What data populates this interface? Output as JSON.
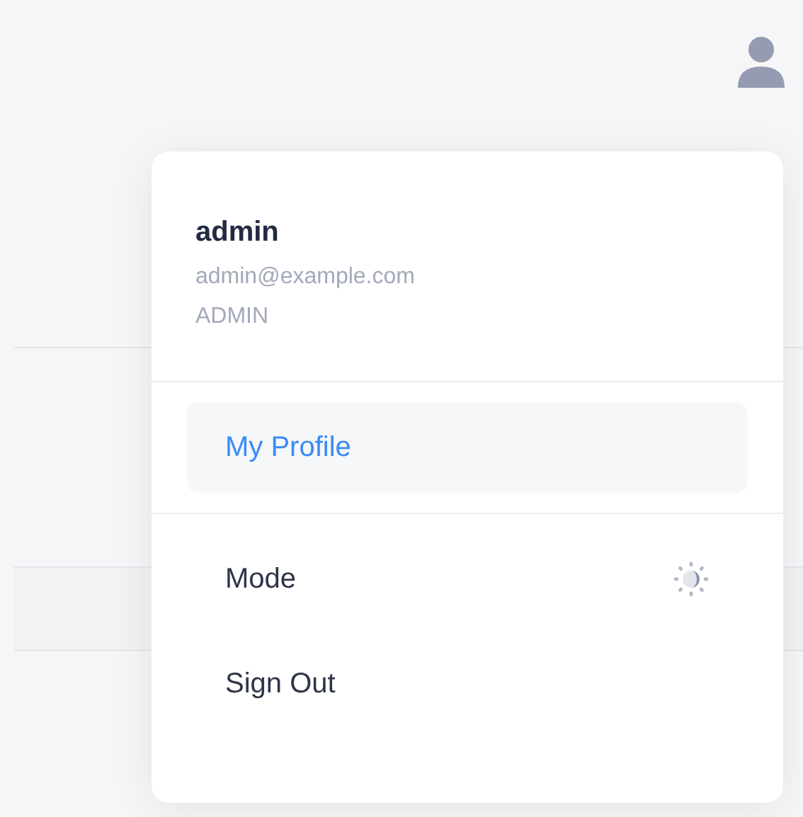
{
  "user": {
    "name": "admin",
    "email": "admin@example.com",
    "role": "ADMIN"
  },
  "menu": [
    {
      "label": "My Profile",
      "kind": "link",
      "selected": true
    },
    {
      "label": "Mode",
      "kind": "toggle",
      "selected": false
    },
    {
      "label": "Sign Out",
      "kind": "link",
      "selected": false
    }
  ]
}
